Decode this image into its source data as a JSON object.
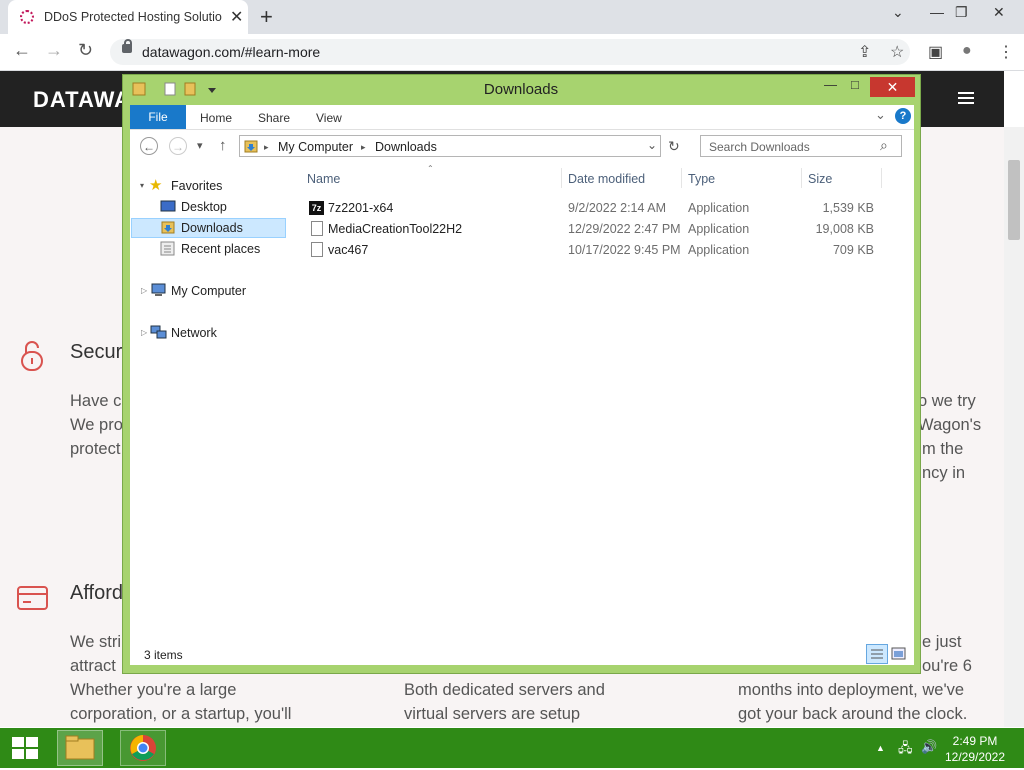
{
  "browser": {
    "tab_title": "DDoS Protected Hosting Solutio",
    "tab_close": "✕",
    "new_tab": "+",
    "url": "datawagon.com/#learn-more",
    "back": "←",
    "forward": "→",
    "reload": "↻",
    "share_icon": "⇪",
    "star_icon": "☆",
    "sidepanel_icon": "▣",
    "profile_icon": "●",
    "menu_icon": "⋮",
    "win_min": "—",
    "win_restore": "❐",
    "win_close": "✕",
    "tabs_chevron": "⌄"
  },
  "site": {
    "logo": "DATAWA",
    "sections": [
      {
        "heading": "Secur",
        "lines": [
          "Have c",
          "We pro",
          "protect"
        ]
      },
      {
        "heading": "Afford",
        "lines": [
          "We stri",
          "attract",
          "Whether you're a large",
          "corporation, or a startup, you'll"
        ]
      }
    ],
    "right_lines_1": [
      "o we try",
      "Wagon's",
      "m the",
      "ncy in"
    ],
    "mid_lines_2": [
      "Both dedicated servers and",
      "virtual servers are setup"
    ],
    "right_lines_2": [
      "e just",
      "ou're 6",
      "months into deployment, we've",
      "got your back around the clock."
    ]
  },
  "explorer": {
    "title": "Downloads",
    "min": "—",
    "max": "□",
    "close": "✕",
    "ribbon_tabs": [
      "File",
      "Home",
      "Share",
      "View"
    ],
    "help": "?",
    "expand_ribbon": "⌄",
    "address": {
      "root": "My Computer",
      "current": "Downloads",
      "sep": "▸"
    },
    "search_placeholder": "Search Downloads",
    "search_icon": "⌕",
    "nav": {
      "back": "←",
      "forward": "→",
      "recent": "▾",
      "up": "↑",
      "refresh": "↻",
      "dropdown": "⌄"
    },
    "tree": {
      "favorites": "Favorites",
      "desktop": "Desktop",
      "downloads": "Downloads",
      "recent": "Recent places",
      "computer": "My Computer",
      "network": "Network"
    },
    "columns": [
      "Name",
      "Date modified",
      "Type",
      "Size"
    ],
    "files": [
      {
        "name": "7z2201-x64",
        "date": "9/2/2022 2:14 AM",
        "type": "Application",
        "size": "1,539 KB"
      },
      {
        "name": "MediaCreationTool22H2",
        "date": "12/29/2022 2:47 PM",
        "type": "Application",
        "size": "19,008 KB"
      },
      {
        "name": "vac467",
        "date": "10/17/2022 9:45 PM",
        "type": "Application",
        "size": "709 KB"
      }
    ],
    "status": "3 items",
    "sevenz_label": "7z"
  },
  "taskbar": {
    "time": "2:49 PM",
    "date": "12/29/2022",
    "tray_arrow": "▲",
    "network_icon": "🖧",
    "volume_icon": "🔊"
  },
  "colors": {
    "window_frame": "#a7d36f",
    "taskbar": "#2f8a16",
    "file_tab": "#1979ca"
  }
}
